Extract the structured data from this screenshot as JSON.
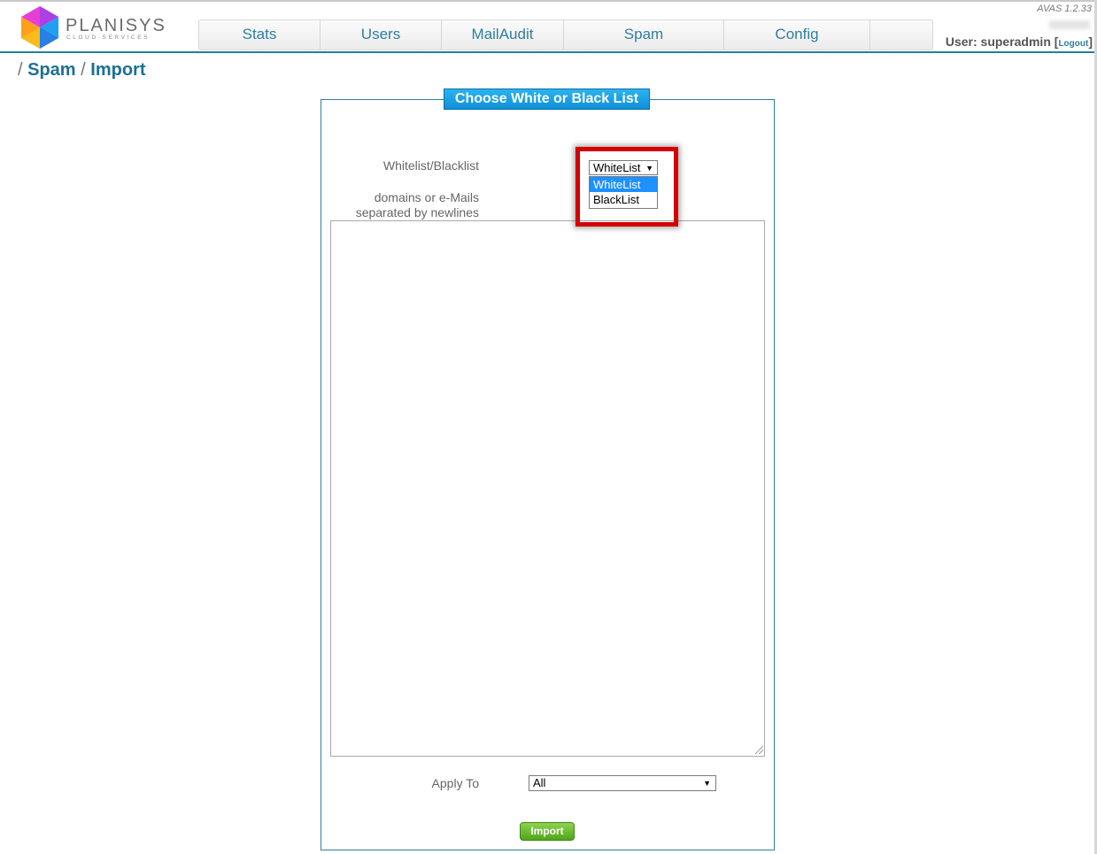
{
  "brand": {
    "name": "PLANISYS",
    "tagline": "CLOUD·SERVICES"
  },
  "nav": {
    "items": [
      "Stats",
      "Users",
      "MailAudit",
      "Spam",
      "Config",
      ""
    ]
  },
  "top_right": {
    "version": "AVAS 1.2.33",
    "user_label": "User: superadmin",
    "logout": "Logout"
  },
  "breadcrumb": {
    "sep": "/",
    "spam": "Spam",
    "import": "Import"
  },
  "form": {
    "legend": "Choose White or Black List",
    "list_label": "Whitelist/Blacklist",
    "list_select": {
      "value": "WhiteList",
      "options": [
        "WhiteList",
        "BlackList"
      ]
    },
    "domains_label_1": "domains or e-Mails",
    "domains_label_2": "separated by newlines",
    "domains_value": "",
    "apply_label": "Apply To",
    "apply_value": "All",
    "import_button": "Import"
  },
  "colors": {
    "accent": "#2f7ea0",
    "legend_bg": "#1ea0e6",
    "highlight": "#d40000",
    "button_green": "#5cb326"
  },
  "icons": {
    "dropdown": "caret-down-icon",
    "resize": "resize-grip-icon"
  }
}
